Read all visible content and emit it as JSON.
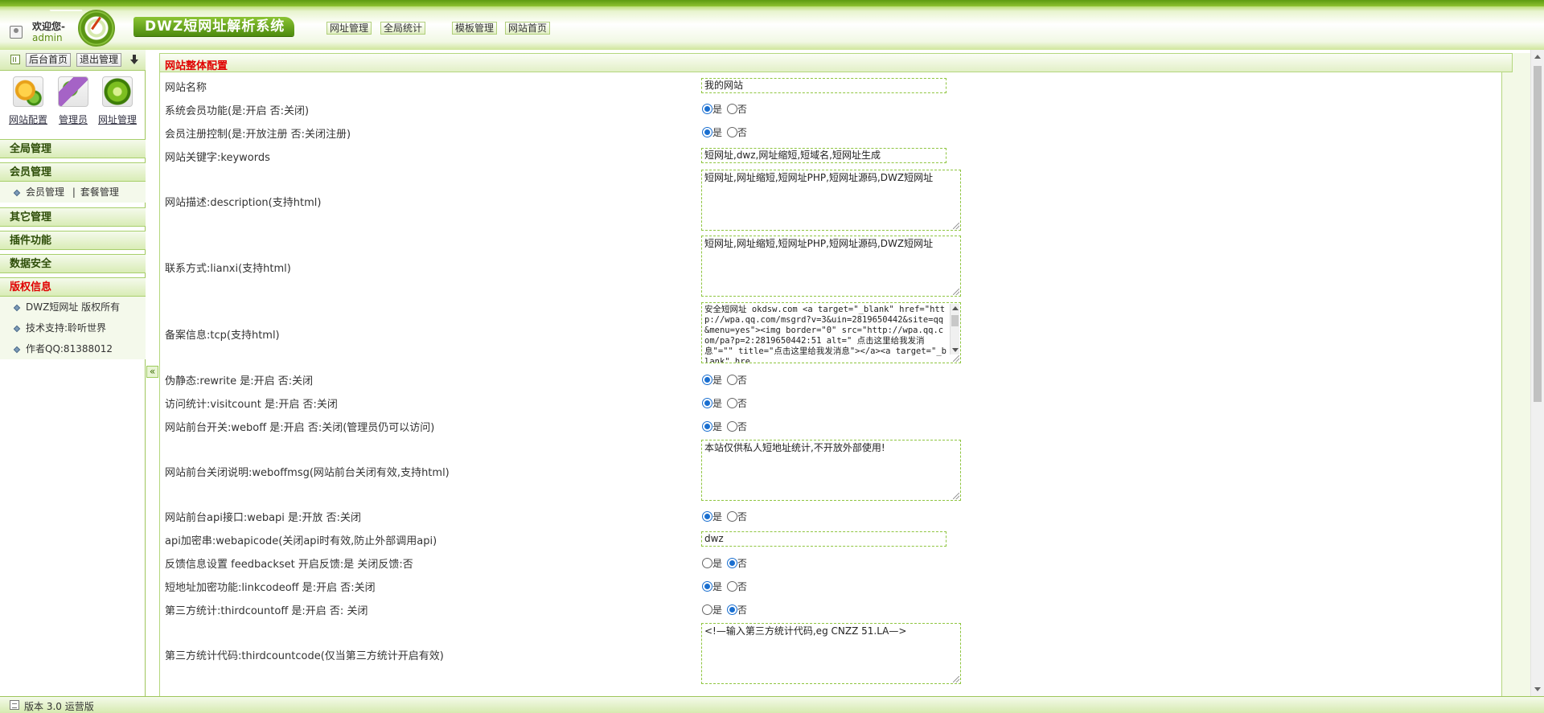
{
  "header": {
    "welcome": "欢迎您-",
    "username": "admin",
    "app_title": "DWZ短网址解析系统",
    "nav": [
      {
        "label": "网址管理"
      },
      {
        "label": "全局统计"
      },
      {
        "label": "模板管理"
      },
      {
        "label": "网站首页"
      }
    ]
  },
  "sidebar": {
    "tools": {
      "home": "后台首页",
      "logout": "退出管理"
    },
    "quick": [
      {
        "label": "网站配置",
        "icon": "site-config-icon"
      },
      {
        "label": "管理员",
        "icon": "admin-icon"
      },
      {
        "label": "网址管理",
        "icon": "url-manage-icon"
      }
    ],
    "menus": {
      "global": "全局管理",
      "member": "会员管理",
      "member_sub": {
        "a": "会员管理",
        "sep": "|",
        "b": "套餐管理"
      },
      "other": "其它管理",
      "plugin": "插件功能",
      "data": "数据安全",
      "copyright": "版权信息",
      "copyright_items": [
        "DWZ短网址 版权所有",
        "技术支持:聆听世界",
        "作者QQ:81388012"
      ]
    },
    "collapse": "«"
  },
  "panel": {
    "title": "网站整体配置",
    "radio_yes": "是",
    "radio_no": "否",
    "fields": {
      "sitename": {
        "label": "网站名称",
        "value": "我的网站"
      },
      "member_func": {
        "label": "系统会员功能(是:开启 否:关闭)",
        "selected": "yes"
      },
      "member_reg": {
        "label": "会员注册控制(是:开放注册 否:关闭注册)",
        "selected": "yes"
      },
      "keywords": {
        "label": "网站关键字:keywords",
        "value": "短网址,dwz,网址缩短,短域名,短网址生成"
      },
      "description": {
        "label": "网站描述:description(支持html)",
        "value": "短网址,网址缩短,短网址PHP,短网址源码,DWZ短网址"
      },
      "lianxi": {
        "label": "联系方式:lianxi(支持html)",
        "value": "短网址,网址缩短,短网址PHP,短网址源码,DWZ短网址"
      },
      "tcp": {
        "label": "备案信息:tcp(支持html)",
        "value": "安全短网址 okdsw.com <a target=\"_blank\" href=\"http://wpa.qq.com/msgrd?v=3&uin=2819650442&site=qq&menu=yes\"><img border=\"0\" src=\"http://wpa.qq.com/pa?p=2:2819650442:51 alt=\" 点击这里给我发消息\"=\"\" title=\"点击这里给我发消息\"></a><a target=\"_blank\" hre"
      },
      "rewrite": {
        "label": "伪静态:rewrite 是:开启 否:关闭",
        "selected": "yes"
      },
      "visitcount": {
        "label": "访问统计:visitcount 是:开启 否:关闭",
        "selected": "yes"
      },
      "weboff": {
        "label": "网站前台开关:weboff 是:开启 否:关闭(管理员仍可以访问)",
        "selected": "yes"
      },
      "weboffmsg": {
        "label": "网站前台关闭说明:weboffmsg(网站前台关闭有效,支持html)",
        "value": "本站仅供私人短地址统计,不开放外部使用!"
      },
      "webapi": {
        "label": "网站前台api接口:webapi 是:开放 否:关闭",
        "selected": "yes"
      },
      "webapicode": {
        "label": "api加密串:webapicode(关闭api时有效,防止外部调用api)",
        "value": "dwz"
      },
      "feedbackset": {
        "label": "反馈信息设置 feedbackset 开启反馈:是 关闭反馈:否",
        "selected": "no"
      },
      "linkcodeoff": {
        "label": "短地址加密功能:linkcodeoff 是:开启 否:关闭",
        "selected": "yes"
      },
      "thirdcountoff": {
        "label": "第三方统计:thirdcountoff 是:开启 否: 关闭",
        "selected": "no"
      },
      "thirdcountcode": {
        "label": "第三方统计代码:thirdcountcode(仅当第三方统计开启有效)",
        "value": "<!—输入第三方统计代码,eg CNZZ 51.LA—>"
      }
    }
  },
  "footer": {
    "text": "版本 3.0 运营版"
  }
}
